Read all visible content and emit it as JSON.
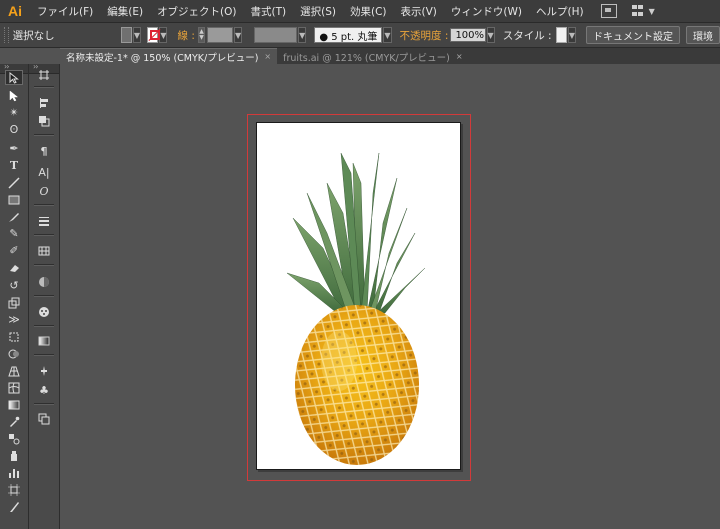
{
  "app": {
    "logo": "Ai"
  },
  "menu": {
    "items": [
      "ファイル(F)",
      "編集(E)",
      "オブジェクト(O)",
      "書式(T)",
      "選択(S)",
      "効果(C)",
      "表示(V)",
      "ウィンドウ(W)",
      "ヘルプ(H)"
    ]
  },
  "control": {
    "selection_label": "選択なし",
    "stroke_label": "線 :",
    "brush_label": "● 5 pt. 丸筆",
    "opacity_label": "不透明度 :",
    "opacity_value": "100%",
    "style_label": "スタイル :",
    "doc_settings": "ドキュメント設定",
    "env_label": "環境"
  },
  "tabs": [
    {
      "label": "名称未設定-1* @ 150% (CMYK/プレビュー)",
      "close": "×"
    },
    {
      "label": "fruits.ai @ 121% (CMYK/プレビュー)",
      "close": "×"
    }
  ],
  "tools": {
    "icons": [
      "selection-tool-icon",
      "direct-selection-tool-icon",
      "magic-wand-tool-icon",
      "lasso-tool-icon",
      "pen-tool-icon",
      "type-tool-icon",
      "line-tool-icon",
      "rectangle-tool-icon",
      "paintbrush-tool-icon",
      "pencil-tool-icon",
      "blob-brush-tool-icon",
      "eraser-tool-icon",
      "rotate-tool-icon",
      "scale-tool-icon",
      "width-tool-icon",
      "free-transform-tool-icon",
      "shape-builder-tool-icon",
      "perspective-grid-tool-icon",
      "mesh-tool-icon",
      "gradient-tool-icon",
      "eyedropper-tool-icon",
      "blend-tool-icon",
      "symbol-sprayer-tool-icon",
      "column-graph-tool-icon",
      "artboard-tool-icon",
      "slice-tool-icon"
    ]
  },
  "panels": {
    "icons": [
      "artboards-panel-icon",
      "align-panel-icon",
      "pathfinder-panel-icon",
      "paragraph-panel-icon",
      "character-panel-icon",
      "opentype-panel-icon",
      "stroke-panel-icon",
      "swatches-panel-icon",
      "color-panel-icon",
      "appearance-panel-icon",
      "gradient-panel-icon",
      "brushes-panel-icon",
      "symbols-panel-icon",
      "layers-panel-icon"
    ]
  },
  "colors": {
    "artboard_outline": "#d23a3a",
    "accent_orange": "#e8a33a",
    "workspace": "#535353"
  }
}
